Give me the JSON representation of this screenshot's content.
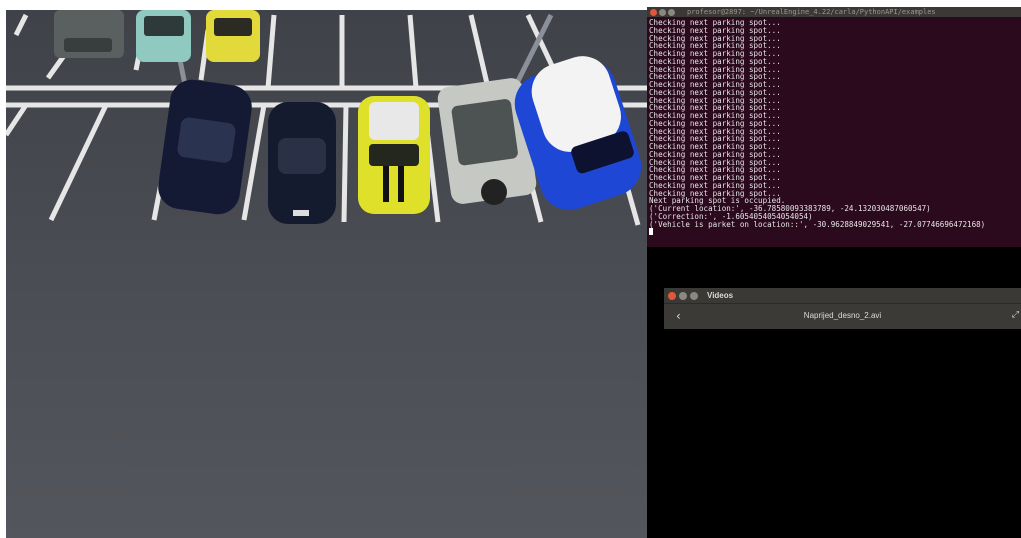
{
  "simulation": {
    "description": "CARLA parking lot top-down view",
    "colors": {
      "asphalt": "#4b4e54",
      "line": "#e8e8e8"
    }
  },
  "terminal": {
    "title": "profesor@2897: ~/UnrealEngine_4.22/carla/PythonAPI/examples",
    "lines": [
      "Checking next parking spot...",
      "Checking next parking spot...",
      "Checking next parking spot...",
      "Checking next parking spot...",
      "Checking next parking spot...",
      "Checking next parking spot...",
      "Checking next parking spot...",
      "Checking next parking spot...",
      "Checking next parking spot...",
      "Checking next parking spot...",
      "Checking next parking spot...",
      "Checking next parking spot...",
      "Checking next parking spot...",
      "Checking next parking spot...",
      "Checking next parking spot...",
      "Checking next parking spot...",
      "Checking next parking spot...",
      "Checking next parking spot...",
      "Checking next parking spot...",
      "Checking next parking spot...",
      "Checking next parking spot...",
      "Checking next parking spot...",
      "Checking next parking spot...",
      "Next parking spot is occupied.",
      "('Current location:', -36.78580093383789, -24.132030487060547)",
      "('Correction:', -1.6054054054054054)",
      "('Vehicle is parket on location::', -30.9628849029541, -27.07746696472168)"
    ],
    "colors": {
      "background": "#2c0a1e",
      "text": "#e7e7e7"
    }
  },
  "video_window": {
    "title": "Videos",
    "back_icon": "chevron-left-icon",
    "filename": "Naprijed_desno_2.avi",
    "resize_icon": "resize-icon"
  }
}
